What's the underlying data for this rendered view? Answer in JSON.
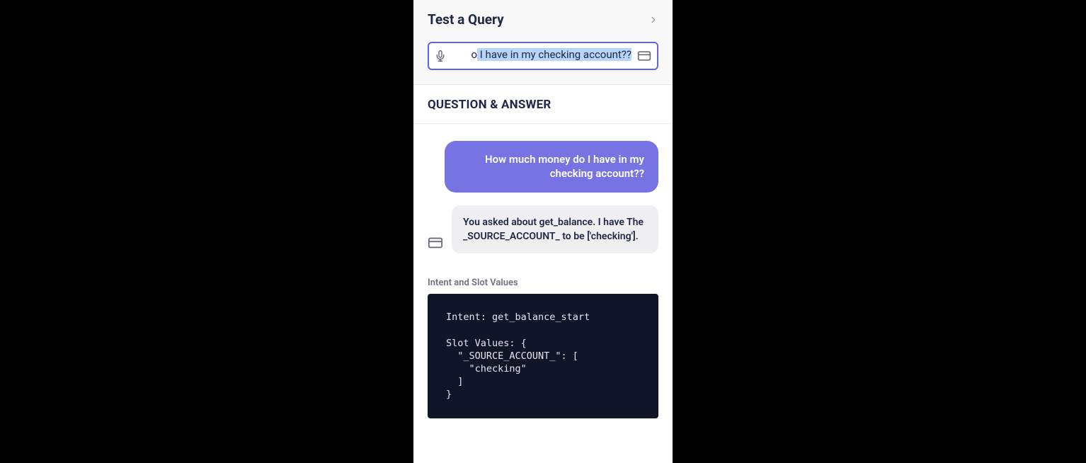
{
  "header": {
    "title": "Test a Query"
  },
  "query_input": {
    "prefix": "o",
    "highlighted": " I have in my checking account??"
  },
  "section_title": "QUESTION & ANSWER",
  "user_message": "How much money do I have in my checking account??",
  "bot_message": "You asked about get_balance. I have The _SOURCE_ACCOUNT_ to be ['checking'].",
  "intent_block_label": "Intent and Slot Values",
  "code": "Intent: get_balance_start\n\nSlot Values: {\n  \"_SOURCE_ACCOUNT_\": [\n    \"checking\"\n  ]\n}"
}
